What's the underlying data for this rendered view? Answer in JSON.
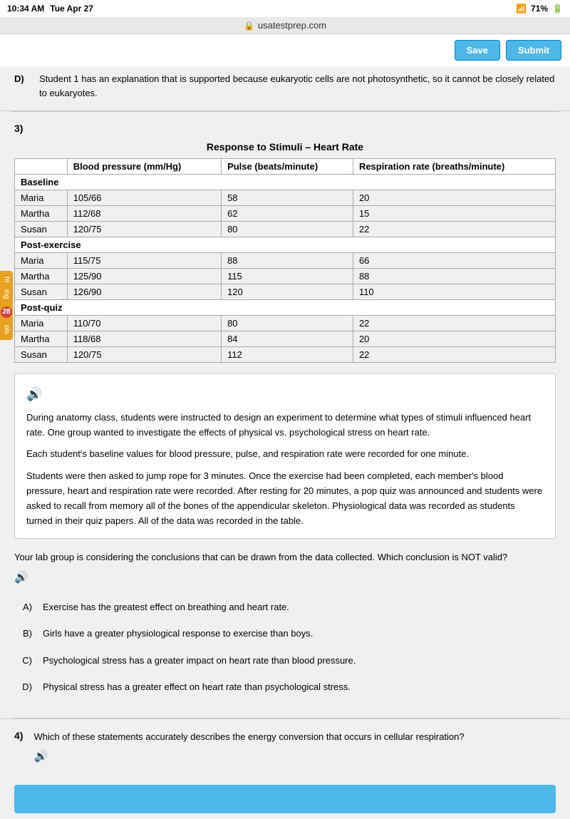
{
  "statusBar": {
    "time": "10:34 AM",
    "date": "Tue Apr 27",
    "battery": "71%",
    "signal": "●●●"
  },
  "urlBar": {
    "url": "usatestprep.com",
    "lock": "🔒"
  },
  "toolbar": {
    "saveLabel": "Save",
    "submitLabel": "Submit"
  },
  "sectionD": {
    "letter": "D)",
    "text": "Student 1 has an explanation that is supported because eukaryotic cells are not photosynthetic, so it cannot be closely related to eukaryotes."
  },
  "question3": {
    "number": "3)",
    "tableTitle": "Response to Stimuli – Heart Rate",
    "tableHeaders": [
      "",
      "Blood pressure (mm/Hg)",
      "Pulse (beats/minute)",
      "Respiration rate (breaths/minute)"
    ],
    "tableRows": [
      {
        "label": "Baseline",
        "bp": "",
        "pulse": "",
        "resp": "",
        "isHeader": true
      },
      {
        "label": "Maria",
        "bp": "105/66",
        "pulse": "58",
        "resp": "20"
      },
      {
        "label": "Martha",
        "bp": "112/68",
        "pulse": "62",
        "resp": "15"
      },
      {
        "label": "Susan",
        "bp": "120/75",
        "pulse": "80",
        "resp": "22"
      },
      {
        "label": "Post-exercise",
        "bp": "",
        "pulse": "",
        "resp": "",
        "isHeader": true
      },
      {
        "label": "Maria",
        "bp": "115/75",
        "pulse": "88",
        "resp": "66"
      },
      {
        "label": "Martha",
        "bp": "125/90",
        "pulse": "115",
        "resp": "88"
      },
      {
        "label": "Susan",
        "bp": "126/90",
        "pulse": "120",
        "resp": "110"
      },
      {
        "label": "Post-quiz",
        "bp": "",
        "pulse": "",
        "resp": "",
        "isHeader": true
      },
      {
        "label": "Maria",
        "bp": "110/70",
        "pulse": "80",
        "resp": "22"
      },
      {
        "label": "Martha",
        "bp": "118/68",
        "pulse": "84",
        "resp": "20"
      },
      {
        "label": "Susan",
        "bp": "120/75",
        "pulse": "112",
        "resp": "22"
      }
    ],
    "infoBox": {
      "para1": "During anatomy class, students were instructed to design an experiment to determine what types of stimuli influenced heart rate. One group wanted to investigate the effects of physical vs. psychological stress on heart rate.",
      "para2": "Each student's baseline values for blood pressure, pulse, and respiration rate were recorded for one minute.",
      "para3": "Students were then asked to jump rope for 3 minutes. Once the exercise had been completed, each member's blood pressure, heart and respiration rate were recorded. After resting for 20 minutes, a pop quiz was announced and students were asked to recall from memory all of the bones of the appendicular skeleton. Physiological data was recorded as students turned in their quiz papers. All of the data was recorded in the table."
    },
    "questionText": "Your lab group is considering the conclusions that can be drawn from the data collected. Which conclusion is NOT valid?",
    "choices": [
      {
        "letter": "A)",
        "text": "Exercise has the greatest effect on breathing and heart rate."
      },
      {
        "letter": "B)",
        "text": "Girls have a greater physiological response to exercise than boys."
      },
      {
        "letter": "C)",
        "text": "Psychological stress has a greater impact on heart rate than blood pressure."
      },
      {
        "letter": "D)",
        "text": "Physical stress has a greater effect on heart rate than psychological stress."
      }
    ]
  },
  "question4": {
    "number": "4)",
    "questionText": "Which of these statements accurately describes the energy conversion that occurs in cellular respiration?"
  },
  "sideTab": {
    "items": [
      "ht",
      "ing",
      "28",
      "ols"
    ]
  }
}
